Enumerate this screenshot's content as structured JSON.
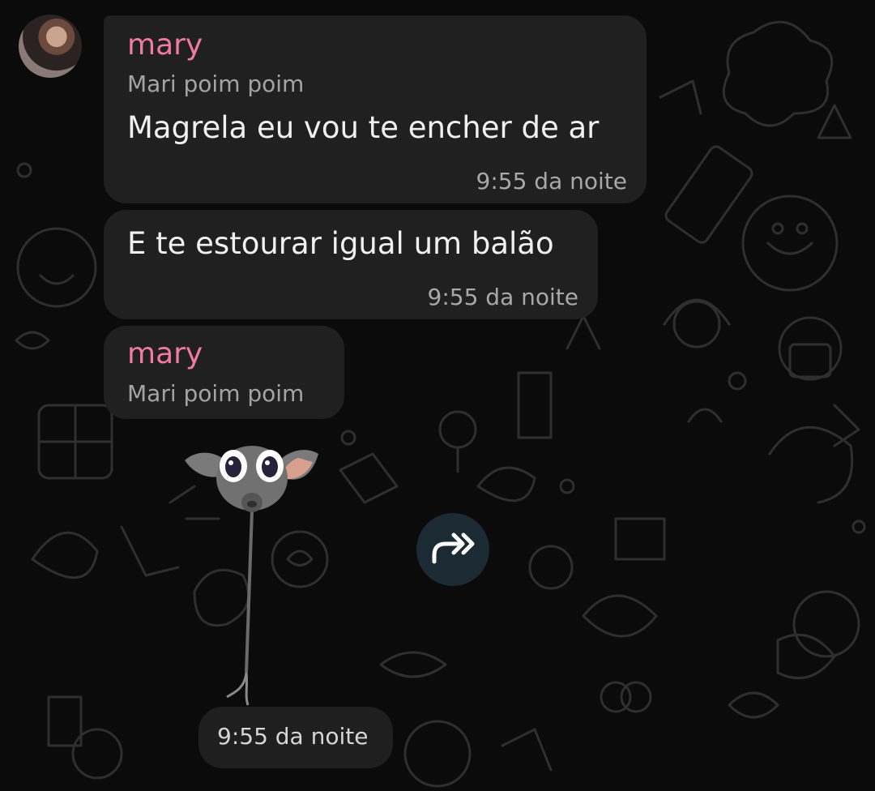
{
  "messages": [
    {
      "sender": "mary",
      "subname": "Mari poim poim",
      "text": "Magrela eu vou te encher de ar",
      "time": "9:55 da noite"
    },
    {
      "text": "E te estourar igual um balão",
      "time": "9:55 da noite"
    },
    {
      "sender": "mary",
      "subname": "Mari poim poim",
      "sticker_time": "9:55 da noite"
    }
  ],
  "icons": {
    "forward": "forward-icon",
    "sticker": "balloon-mouse-sticker",
    "avatar": "contact-avatar"
  },
  "colors": {
    "background": "#0b0b0b",
    "bubble": "#202020",
    "sender_name": "#f17aa3",
    "timestamp": "#a8a8a8",
    "forward_button": "#1b2a33"
  }
}
